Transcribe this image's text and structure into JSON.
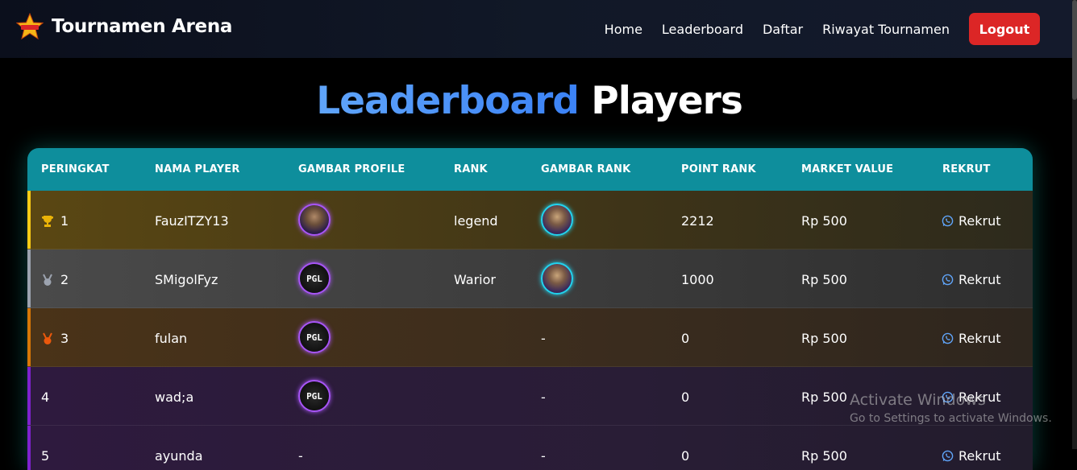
{
  "navbar": {
    "brand": "Tournamen Arena",
    "links": [
      "Home",
      "Leaderboard",
      "Daftar",
      "Riwayat Tournamen"
    ],
    "logout": "Logout"
  },
  "page": {
    "title_accent": "Leaderboard",
    "title_rest": "Players"
  },
  "table": {
    "headers": [
      "PERINGKAT",
      "NAMA PLAYER",
      "GAMBAR PROFILE",
      "RANK",
      "GAMBAR RANK",
      "POINT RANK",
      "MARKET VALUE",
      "REKRUT"
    ],
    "rows": [
      {
        "rank": "1",
        "name": "FauzITZY13",
        "profile": "profile-image",
        "tier": "legend",
        "tier_image": "rank-image",
        "points": "2212",
        "market": "Rp 500",
        "action": "Rekrut",
        "medal": "trophy-icon"
      },
      {
        "rank": "2",
        "name": "SMigolFyz",
        "profile": "pgl-image",
        "tier": "Warior",
        "tier_image": "rank-image",
        "points": "1000",
        "market": "Rp 500",
        "action": "Rekrut",
        "medal": "silver-medal-icon"
      },
      {
        "rank": "3",
        "name": "fulan",
        "profile": "pgl-image",
        "tier": "",
        "tier_image": "-",
        "points": "0",
        "market": "Rp 500",
        "action": "Rekrut",
        "medal": "bronze-medal-icon"
      },
      {
        "rank": "4",
        "name": "wad;a",
        "profile": "pgl-image",
        "tier": "",
        "tier_image": "-",
        "points": "0",
        "market": "Rp 500",
        "action": "Rekrut",
        "medal": ""
      },
      {
        "rank": "5",
        "name": "ayunda",
        "profile": "-",
        "tier": "",
        "tier_image": "-",
        "points": "0",
        "market": "Rp 500",
        "action": "Rekrut",
        "medal": ""
      }
    ]
  },
  "pgl_text": "PGL",
  "watermark": {
    "title": "Activate Windows",
    "subtitle": "Go to Settings to activate Windows."
  },
  "colors": {
    "header_bg": "#0e8e9c",
    "accent_blue": "#60a5fa",
    "logout_red": "#dc2626",
    "row1_gold": "#facc15",
    "row2_silver": "#9ca3af",
    "row3_bronze": "#d97706",
    "row4_purple": "#7e22ce"
  }
}
